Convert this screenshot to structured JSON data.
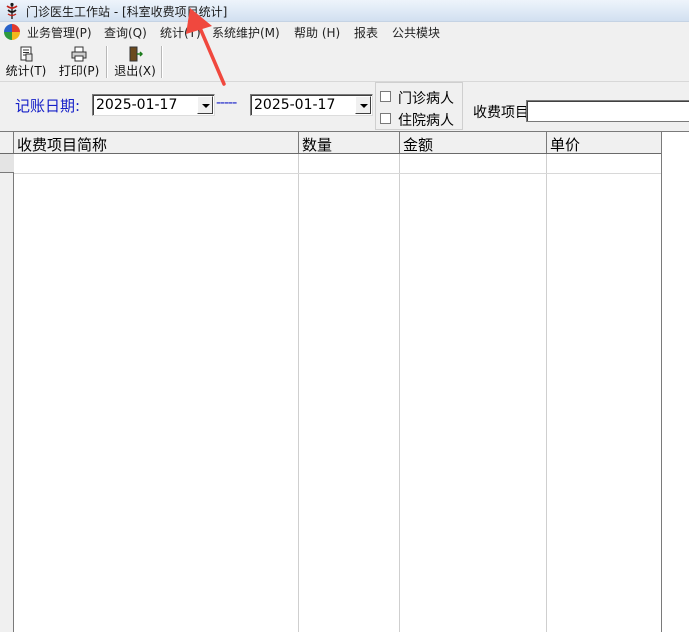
{
  "window": {
    "title": "门诊医生工作站 - [科室收费项目统计]"
  },
  "menu": {
    "items": [
      {
        "label": "业务管理(P)"
      },
      {
        "label": "查询(Q)"
      },
      {
        "label": "统计(T)"
      },
      {
        "label": "系统维护(M)"
      },
      {
        "label": "帮助 (H)"
      },
      {
        "label": "报表"
      },
      {
        "label": "公共模块"
      }
    ]
  },
  "toolbar": {
    "stats_label": "统计(T)",
    "print_label": "打印(P)",
    "exit_label": "退出(X)"
  },
  "filter": {
    "date_label": "记账日期:",
    "start_date": "2025-01-17",
    "separator": "-----",
    "end_date": "2025-01-17",
    "outpatient_label": "门诊病人",
    "inpatient_label": "住院病人",
    "fee_item_label": "收费项目",
    "fee_item_value": ""
  },
  "grid": {
    "columns": [
      {
        "header": "收费项目简称"
      },
      {
        "header": "数量"
      },
      {
        "header": "金额"
      },
      {
        "header": "单价"
      }
    ]
  },
  "colors": {
    "accent_blue": "#1620c8",
    "annotation_arrow": "#f0483e"
  }
}
